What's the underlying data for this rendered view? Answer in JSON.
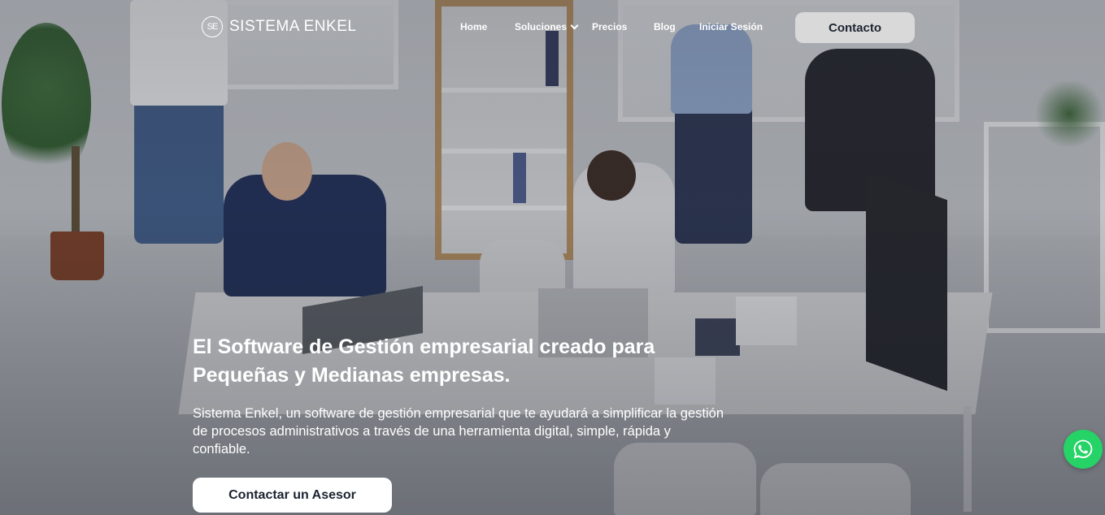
{
  "brand": {
    "logo_mark": "SE",
    "name": "SISTEMA ENKEL"
  },
  "nav": {
    "home": "Home",
    "soluciones": "Soluciones",
    "precios": "Precios",
    "blog": "Blog",
    "login": "Iniciar Sesión",
    "contact_button": "Contacto"
  },
  "hero": {
    "title_line1": "El Software de Gestión empresarial creado para",
    "title_line2": "Pequeñas y Medianas empresas.",
    "description": "Sistema Enkel, un software de gestión empresarial que te ayudará a simplificar la gestión de procesos administrativos a través de una herramienta digital, simple, rápida y confiable.",
    "cta_label": "Contactar un Asesor"
  },
  "icons": {
    "logo": "se-logo-icon",
    "dropdown": "chevron-down-icon",
    "whatsapp": "whatsapp-icon"
  },
  "colors": {
    "whatsapp": "#25d366",
    "button_text": "#1c2430",
    "contact_button_bg": "#d9d9da"
  }
}
